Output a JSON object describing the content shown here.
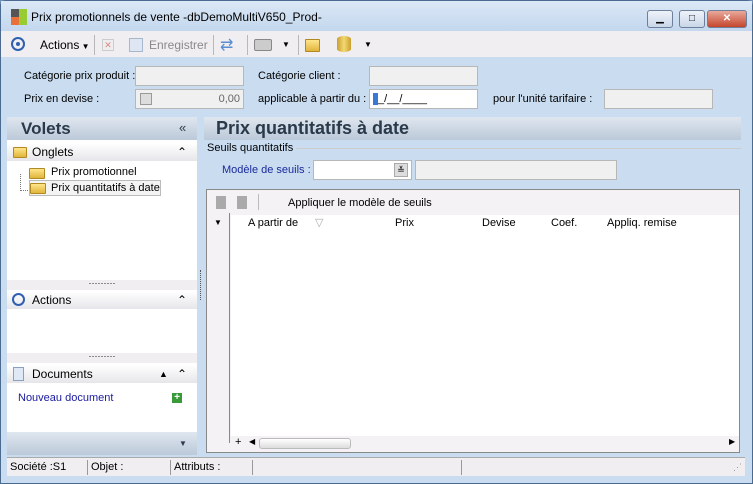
{
  "window": {
    "title": "Prix promotionnels de vente -dbDemoMultiV650_Prod-",
    "minimize": "▁",
    "maximize": "□",
    "close": "✕"
  },
  "toolbar": {
    "actions_label": "Actions",
    "save_label": "Enregistrer"
  },
  "form": {
    "categorie_prix_produit_label": "Catégorie prix produit :",
    "categorie_prix_produit_value": "",
    "categorie_client_label": "Catégorie client :",
    "categorie_client_value": "",
    "prix_en_devise_label": "Prix en devise :",
    "prix_en_devise_value": "0,00",
    "applicable_label": "applicable à partir du :",
    "applicable_value": "_/__/____",
    "unite_tarifaire_label": "pour l'unité tarifaire :",
    "unite_tarifaire_value": ""
  },
  "sidebar": {
    "title": "Volets",
    "collapse": "«",
    "onglets": {
      "title": "Onglets",
      "items": [
        {
          "label": "Prix promotionnel"
        },
        {
          "label": "Prix quantitatifs à date",
          "selected": true
        }
      ]
    },
    "actions": {
      "title": "Actions"
    },
    "documents": {
      "title": "Documents",
      "new_document": "Nouveau document"
    }
  },
  "main": {
    "title": "Prix quantitatifs à date",
    "group_label": "Seuils quantitatifs",
    "modele_label": "Modèle de seuils :",
    "modele_value": "",
    "modele_desc": "",
    "apply_button": "Appliquer le modèle de seuils",
    "columns": [
      "A partir de",
      "Prix",
      "Devise",
      "Coef.",
      "Appliq. remise"
    ],
    "rows": [],
    "add_row": "+"
  },
  "statusbar": {
    "societe": "Société :S1",
    "objet": "Objet :",
    "attributs": "Attributs :"
  },
  "colors": {
    "accent": "#2f5fb0",
    "link": "#1a1aa0",
    "frame": "#c9dcf0"
  }
}
